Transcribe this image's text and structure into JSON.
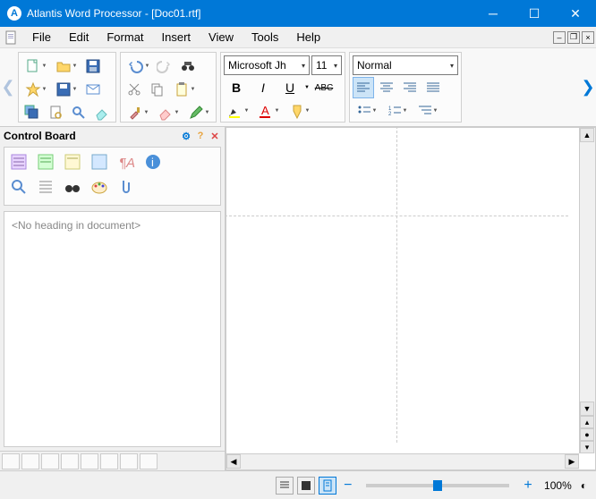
{
  "title": "Atlantis Word Processor - [Doc01.rtf]",
  "menu": [
    "File",
    "Edit",
    "Format",
    "Insert",
    "View",
    "Tools",
    "Help"
  ],
  "font": {
    "name": "Microsoft Jh",
    "size": "11",
    "style": "Normal"
  },
  "format_buttons": {
    "bold": "B",
    "italic": "I",
    "underline": "U",
    "strike": "ABC"
  },
  "control_board": {
    "title": "Control Board",
    "placeholder": "<No heading in document>"
  },
  "zoom": {
    "percent": "100%",
    "minus": "−",
    "plus": "+"
  }
}
